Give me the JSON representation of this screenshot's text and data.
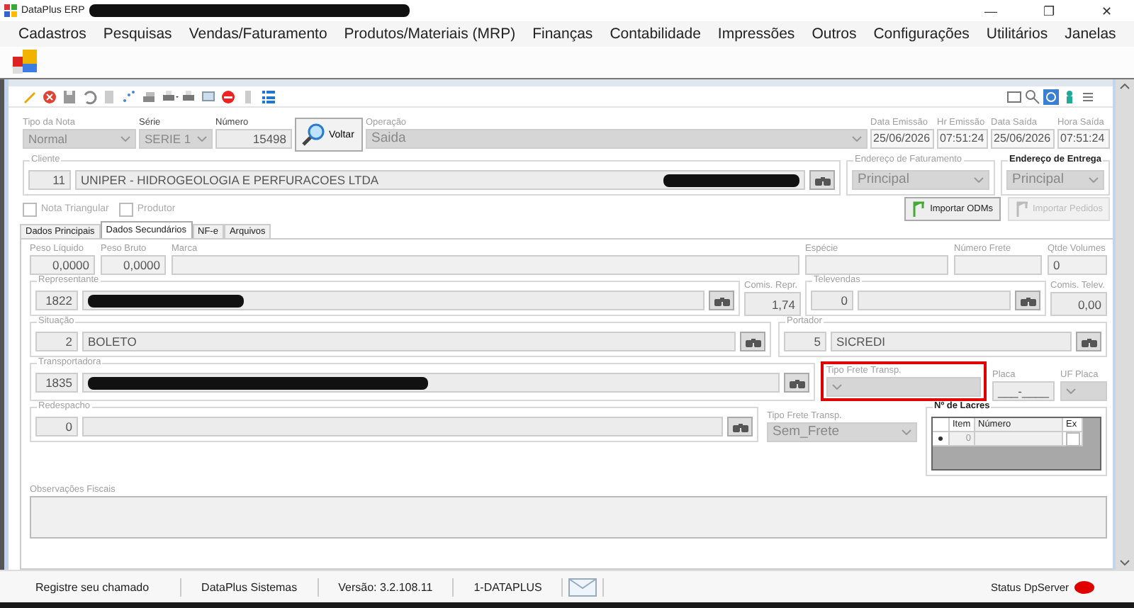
{
  "window": {
    "title": "DataPlus ERP",
    "controls": [
      "—",
      "❐",
      "✕"
    ]
  },
  "menu": [
    "Cadastros",
    "Pesquisas",
    "Vendas/Faturamento",
    "Produtos/Materiais (MRP)",
    "Finanças",
    "Contabilidade",
    "Impressões",
    "Outros",
    "Configurações",
    "Utilitários",
    "Janelas"
  ],
  "header": {
    "tipo_da_nota": {
      "label": "Tipo da Nota",
      "value": "Normal"
    },
    "serie": {
      "label": "Série",
      "value": "SERIE 1"
    },
    "numero": {
      "label": "Número",
      "value": "15498"
    },
    "voltar_button": "Voltar",
    "operacao": {
      "label": "Operação",
      "value": "Saida"
    },
    "dates": [
      {
        "label": "Data Emissão",
        "value": "25/06/2026"
      },
      {
        "label": "Hr Emissão",
        "value": "07:51:24"
      },
      {
        "label": "Data Saída",
        "value": "25/06/2026"
      },
      {
        "label": "Hora Saída",
        "value": "07:51:24"
      }
    ]
  },
  "cliente": {
    "label": "Cliente",
    "code": "11",
    "name": "UNIPER - HIDROGEOLOGIA E PERFURACOES LTDA"
  },
  "enderecos": [
    {
      "label": "Endereço de Faturamento",
      "value": "Principal",
      "disabled": true
    },
    {
      "label": "Endereço de Entrega",
      "value": "Principal",
      "disabled": false
    }
  ],
  "checkboxes": [
    {
      "label": "Nota Triangular",
      "checked": false
    },
    {
      "label": "Produtor",
      "checked": false
    }
  ],
  "import_buttons": [
    {
      "label": "Importar ODMs",
      "disabled": false
    },
    {
      "label": "Importar Pedidos",
      "disabled": true
    }
  ],
  "tabs": [
    {
      "label": "Dados Principais",
      "selected": false
    },
    {
      "label": "Dados Secundários",
      "selected": true
    },
    {
      "label": "NF-e",
      "selected": false
    },
    {
      "label": "Arquivos",
      "selected": false
    }
  ],
  "row1": [
    {
      "label": "Peso Líquido",
      "value": "0,0000"
    },
    {
      "label": "Peso Bruto",
      "value": "0,0000"
    },
    {
      "label": "Marca"
    },
    {
      "label": "Espécie"
    },
    {
      "label": "Número Frete"
    },
    {
      "label": "Qtde Volumes",
      "value": "0"
    }
  ],
  "representante": {
    "label": "Representante",
    "code": "1822"
  },
  "comis_repr": {
    "label": "Comis. Repr.",
    "value": "1,74"
  },
  "televendas": {
    "label": "Televendas",
    "code": "0"
  },
  "comis_telev": {
    "label": "Comis. Telev.",
    "value": "0,00"
  },
  "situacao": {
    "label": "Situação",
    "code": "2",
    "name": "BOLETO"
  },
  "portador": {
    "label": "Portador",
    "code": "5",
    "name": "SICREDI"
  },
  "transportadora": {
    "label": "Transportadora",
    "code": "1835"
  },
  "tipo_frete_transp": {
    "label": "Tipo Frete Transp.",
    "highlighted": true
  },
  "placa": {
    "label": "Placa",
    "value": "___-____"
  },
  "uf_placa": {
    "label": "UF Placa"
  },
  "redespacho": {
    "label": "Redespacho",
    "code": "0"
  },
  "tipo_frete_redespacho": {
    "label": "Tipo Frete Transp.",
    "value": "Sem_Frete"
  },
  "lacres": {
    "label": "Nº de Lacres",
    "columns": [
      "Item",
      "Número",
      "Ex"
    ],
    "rows": [
      {
        "item": "0",
        "ex": false
      }
    ]
  },
  "observacoes": {
    "label": "Observações Fiscais"
  },
  "status_bar": {
    "items": [
      "Registre seu chamado",
      "DataPlus Sistemas",
      "Versão: 3.2.108.11",
      "1-DATAPLUS"
    ],
    "server_label": "Status DpServer"
  }
}
